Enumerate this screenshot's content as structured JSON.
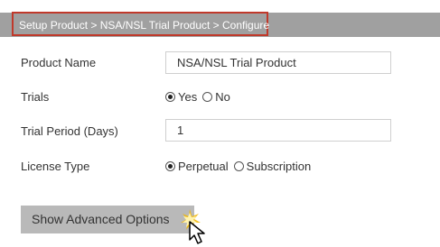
{
  "breadcrumb": "Setup Product > NSA/NSL Trial Product > Configure",
  "form": {
    "product_name_label": "Product Name",
    "product_name_value": "NSA/NSL Trial Product",
    "trials_label": "Trials",
    "trials_options": [
      {
        "label": "Yes",
        "selected": true
      },
      {
        "label": "No",
        "selected": false
      }
    ],
    "trial_period_label": "Trial Period (Days)",
    "trial_period_value": "1",
    "license_type_label": "License Type",
    "license_options": [
      {
        "label": "Perpetual",
        "selected": true
      },
      {
        "label": "Subscription",
        "selected": false
      }
    ]
  },
  "advanced_button_label": "Show Advanced Options",
  "colors": {
    "header_bar": "#a0a0a0",
    "breadcrumb_border": "#c0392b",
    "button_bg": "#b9b9b9",
    "click_burst": "#f2b705"
  },
  "icons": [
    "mouse-pointer-icon",
    "click-burst-icon"
  ]
}
